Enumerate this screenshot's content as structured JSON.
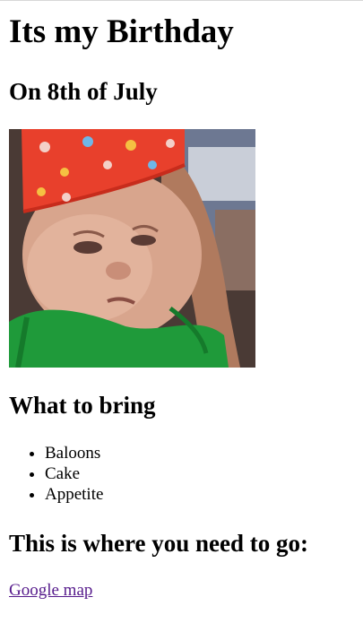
{
  "page": {
    "title": "Its my Birthday",
    "subtitle": "On 8th of July"
  },
  "photo": {
    "alt_icon": "birthday-baby-photo"
  },
  "bring": {
    "heading": "What to bring",
    "items": [
      {
        "label": "Baloons"
      },
      {
        "label": "Cake"
      },
      {
        "label": "Appetite"
      }
    ]
  },
  "location": {
    "heading": "This is where you need to go:",
    "link_label": "Google map"
  },
  "colors": {
    "link_visited": "#551a8b",
    "hat_red": "#e8402c",
    "shirt_green": "#1f9a3a"
  }
}
